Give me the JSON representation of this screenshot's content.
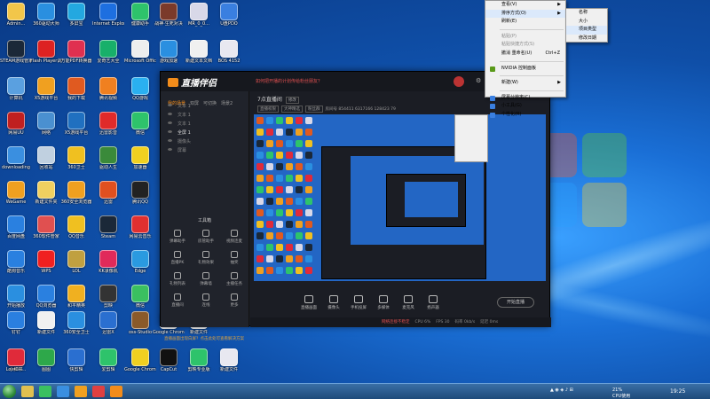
{
  "desktop_icons": [
    {
      "label": "Admin...",
      "color": "#f2c64a"
    },
    {
      "label": "360驱动大师",
      "color": "#2a8fe0"
    },
    {
      "label": "多屏宝",
      "color": "#23a8e0"
    },
    {
      "label": "Internet Explorer",
      "color": "#1d6fe0"
    },
    {
      "label": "健康助手",
      "color": "#2ec36b"
    },
    {
      "label": "战神·生死对决",
      "color": "#7b3a2a"
    },
    {
      "label": "MR_0_0...",
      "color": "#d8d8e8"
    },
    {
      "label": "U盘PDO",
      "color": "#3a7fe0"
    },
    {
      "label": "STEAM游戏管家",
      "color": "#1b2838"
    },
    {
      "label": "Flash Player调试工具",
      "color": "#d22"
    },
    {
      "label": "万能PDF转换器",
      "color": "#e03050"
    },
    {
      "label": "爱奇艺大全",
      "color": "#18b06a"
    },
    {
      "label": "Microsoft Office",
      "color": "#eeeeee"
    },
    {
      "label": "游戏加速",
      "color": "#2a8fe0"
    },
    {
      "label": "新建文本文档",
      "color": "#f0f0f0"
    },
    {
      "label": "BOS 4152",
      "color": "#e8e8f0"
    },
    {
      "label": "计算机",
      "color": "#5aa0e0"
    },
    {
      "label": "X5游戏平台",
      "color": "#f0a020"
    },
    {
      "label": "我的下载",
      "color": "#e05a20"
    },
    {
      "label": "腾讯视频",
      "color": "#f08020"
    },
    {
      "label": "QQ游戏",
      "color": "#2ab0f0"
    },
    {
      "label": "网易UU",
      "color": "#c02020"
    },
    {
      "label": "网络",
      "color": "#4a90d0"
    },
    {
      "label": "X5游戏平台",
      "color": "#2070c0"
    },
    {
      "label": "迅雷影音",
      "color": "#e02a2a"
    },
    {
      "label": "微信",
      "color": "#2ec36b"
    },
    {
      "label": "downloading",
      "color": "#3a8fe0"
    },
    {
      "label": "回收站",
      "color": "#c0d0e0"
    },
    {
      "label": "360卫士",
      "color": "#f0c020"
    },
    {
      "label": "驱动人生",
      "color": "#3a8a3a"
    },
    {
      "label": "加速器",
      "color": "#f0d020"
    },
    {
      "label": "WeGame",
      "color": "#f0a020"
    },
    {
      "label": "新建文件夹",
      "color": "#f0d060"
    },
    {
      "label": "360安全浏览器",
      "color": "#f0a020"
    },
    {
      "label": "迅雷",
      "color": "#e05020"
    },
    {
      "label": "腾讯QQ",
      "color": "#222"
    },
    {
      "label": "百度网盘",
      "color": "#2a80e0"
    },
    {
      "label": "360软件管家",
      "color": "#e05050"
    },
    {
      "label": "QQ音乐",
      "color": "#f0c020"
    },
    {
      "label": "Steam",
      "color": "#1b2838"
    },
    {
      "label": "网易云音乐",
      "color": "#e03030"
    },
    {
      "label": "酷狗音乐",
      "color": "#2a80e0"
    },
    {
      "label": "WPS",
      "color": "#f02020"
    },
    {
      "label": "LOL",
      "color": "#c0a040"
    },
    {
      "label": "KK录像机",
      "color": "#e02a5a"
    },
    {
      "label": "Edge",
      "color": "#2a9ae0"
    },
    {
      "label": "开始播放",
      "color": "#2a8fe0"
    },
    {
      "label": "QQ浏览器",
      "color": "#2a80e0"
    },
    {
      "label": "和平精英",
      "color": "#f0b020"
    },
    {
      "label": "剪映",
      "color": "#333"
    },
    {
      "label": "微信",
      "color": "#3ac060"
    },
    {
      "label": "钉钉",
      "color": "#2a7fe0"
    },
    {
      "label": "新建文件",
      "color": "#f0f0f0"
    },
    {
      "label": "360安全卫士",
      "color": "#2a8fe0"
    },
    {
      "label": "迅雷X",
      "color": "#2a6fd0"
    },
    {
      "label": "oss-Studio",
      "color": "#8a5a2a"
    },
    {
      "label": "Google Chrome",
      "color": "#e8e8e8"
    },
    {
      "label": "新建文件",
      "color": "#f0f0f0"
    },
    {
      "label": "Lovelin...",
      "color": "#e0e0f0"
    },
    {
      "label": "图图",
      "color": "#2ea84a"
    },
    {
      "label": "快剪辑",
      "color": "#2a6fd0"
    },
    {
      "label": "爱剪辑",
      "color": "#2ec36b"
    },
    {
      "label": "Google Chrome",
      "color": "#f0d020"
    },
    {
      "label": "CapCut",
      "color": "#111"
    },
    {
      "label": "剪映专业版",
      "color": "#2ec36b"
    },
    {
      "label": "新建文件",
      "color": "#e8e8f0"
    },
    {
      "label": "小红书",
      "color": "#e02a3a"
    }
  ],
  "app": {
    "brand": "直播伴侣",
    "top_note": "如何把开播的计划传给粉丝朋友？",
    "side_tabs": [
      {
        "label": "我的场景",
        "active": true
      },
      {
        "label": "双屏",
        "active": false
      },
      {
        "label": "可切换",
        "active": false
      },
      {
        "label": "场景2",
        "active": false
      }
    ],
    "scenes": [
      {
        "label": "文本 1",
        "active": false
      },
      {
        "label": "文本 1",
        "active": false
      },
      {
        "label": "文本 1",
        "active": false
      },
      {
        "label": "全屏 1",
        "active": true
      },
      {
        "label": "摄像头",
        "active": false
      },
      {
        "label": "屏幕",
        "active": false
      }
    ],
    "tools_title": "工具箱",
    "tools": [
      "弹幕助手",
      "房管助手",
      "视频连麦",
      "直播PK",
      "礼物效果",
      "抽奖",
      "礼物列表",
      "弹幕墙",
      "主播任务",
      "直播间",
      "连线",
      "更多"
    ],
    "side_footer": "直播画面出现白屏？点击此处可查看解决方案",
    "room_title": "7点直播间",
    "room_edit": "修改",
    "info_chips": [
      "直播权限",
      "大神精选",
      "粉丝群"
    ],
    "info_stats": "房间号 854411  6317166  128423  79",
    "controls": [
      "直播画面",
      "摄像头",
      "手机投屏",
      "多媒体",
      "麦克风",
      "扬声器"
    ],
    "start_button": "开始直播",
    "status": {
      "warn": "网络连接不稳定",
      "items": [
        "CPU 6%",
        "FPS 30",
        "码率 0kb/s",
        "延迟 0ms"
      ]
    }
  },
  "context_menu": {
    "items": [
      {
        "label": "查看(V)",
        "arrow": true,
        "disabled": false,
        "shortcut": ""
      },
      {
        "label": "排序方式(O)",
        "arrow": true,
        "disabled": false,
        "shortcut": "",
        "highlight": true
      },
      {
        "label": "刷新(E)",
        "arrow": false,
        "disabled": false,
        "shortcut": ""
      },
      {
        "sep": true
      },
      {
        "label": "粘贴(P)",
        "arrow": false,
        "disabled": true,
        "shortcut": ""
      },
      {
        "label": "粘贴快捷方式(S)",
        "arrow": false,
        "disabled": true,
        "shortcut": ""
      },
      {
        "label": "撤消 重命名(U)",
        "arrow": false,
        "disabled": false,
        "shortcut": "Ctrl+Z"
      },
      {
        "sep": true
      },
      {
        "label": "NVIDIA 控制面板",
        "arrow": false,
        "disabled": false,
        "shortcut": "",
        "icon": "#5a9a1a"
      },
      {
        "sep": true
      },
      {
        "label": "新建(W)",
        "arrow": true,
        "disabled": false,
        "shortcut": ""
      },
      {
        "sep": true
      },
      {
        "label": "屏幕分辨率(C)",
        "arrow": false,
        "disabled": false,
        "shortcut": "",
        "icon": "#3a7fe0"
      },
      {
        "label": "小工具(G)",
        "arrow": false,
        "disabled": false,
        "shortcut": "",
        "icon": "#3a7fe0"
      },
      {
        "label": "个性化(R)",
        "arrow": false,
        "disabled": false,
        "shortcut": "",
        "icon": "#3a7fe0"
      }
    ]
  },
  "sub_menu": {
    "items": [
      {
        "label": "名称",
        "highlight": false
      },
      {
        "label": "大小",
        "highlight": false
      },
      {
        "label": "项目类型",
        "highlight": true
      },
      {
        "label": "修改日期",
        "highlight": false
      }
    ]
  },
  "taskbar": {
    "clock": "19:25",
    "tray_text": "21%",
    "tray_sub": "CPU使用"
  }
}
